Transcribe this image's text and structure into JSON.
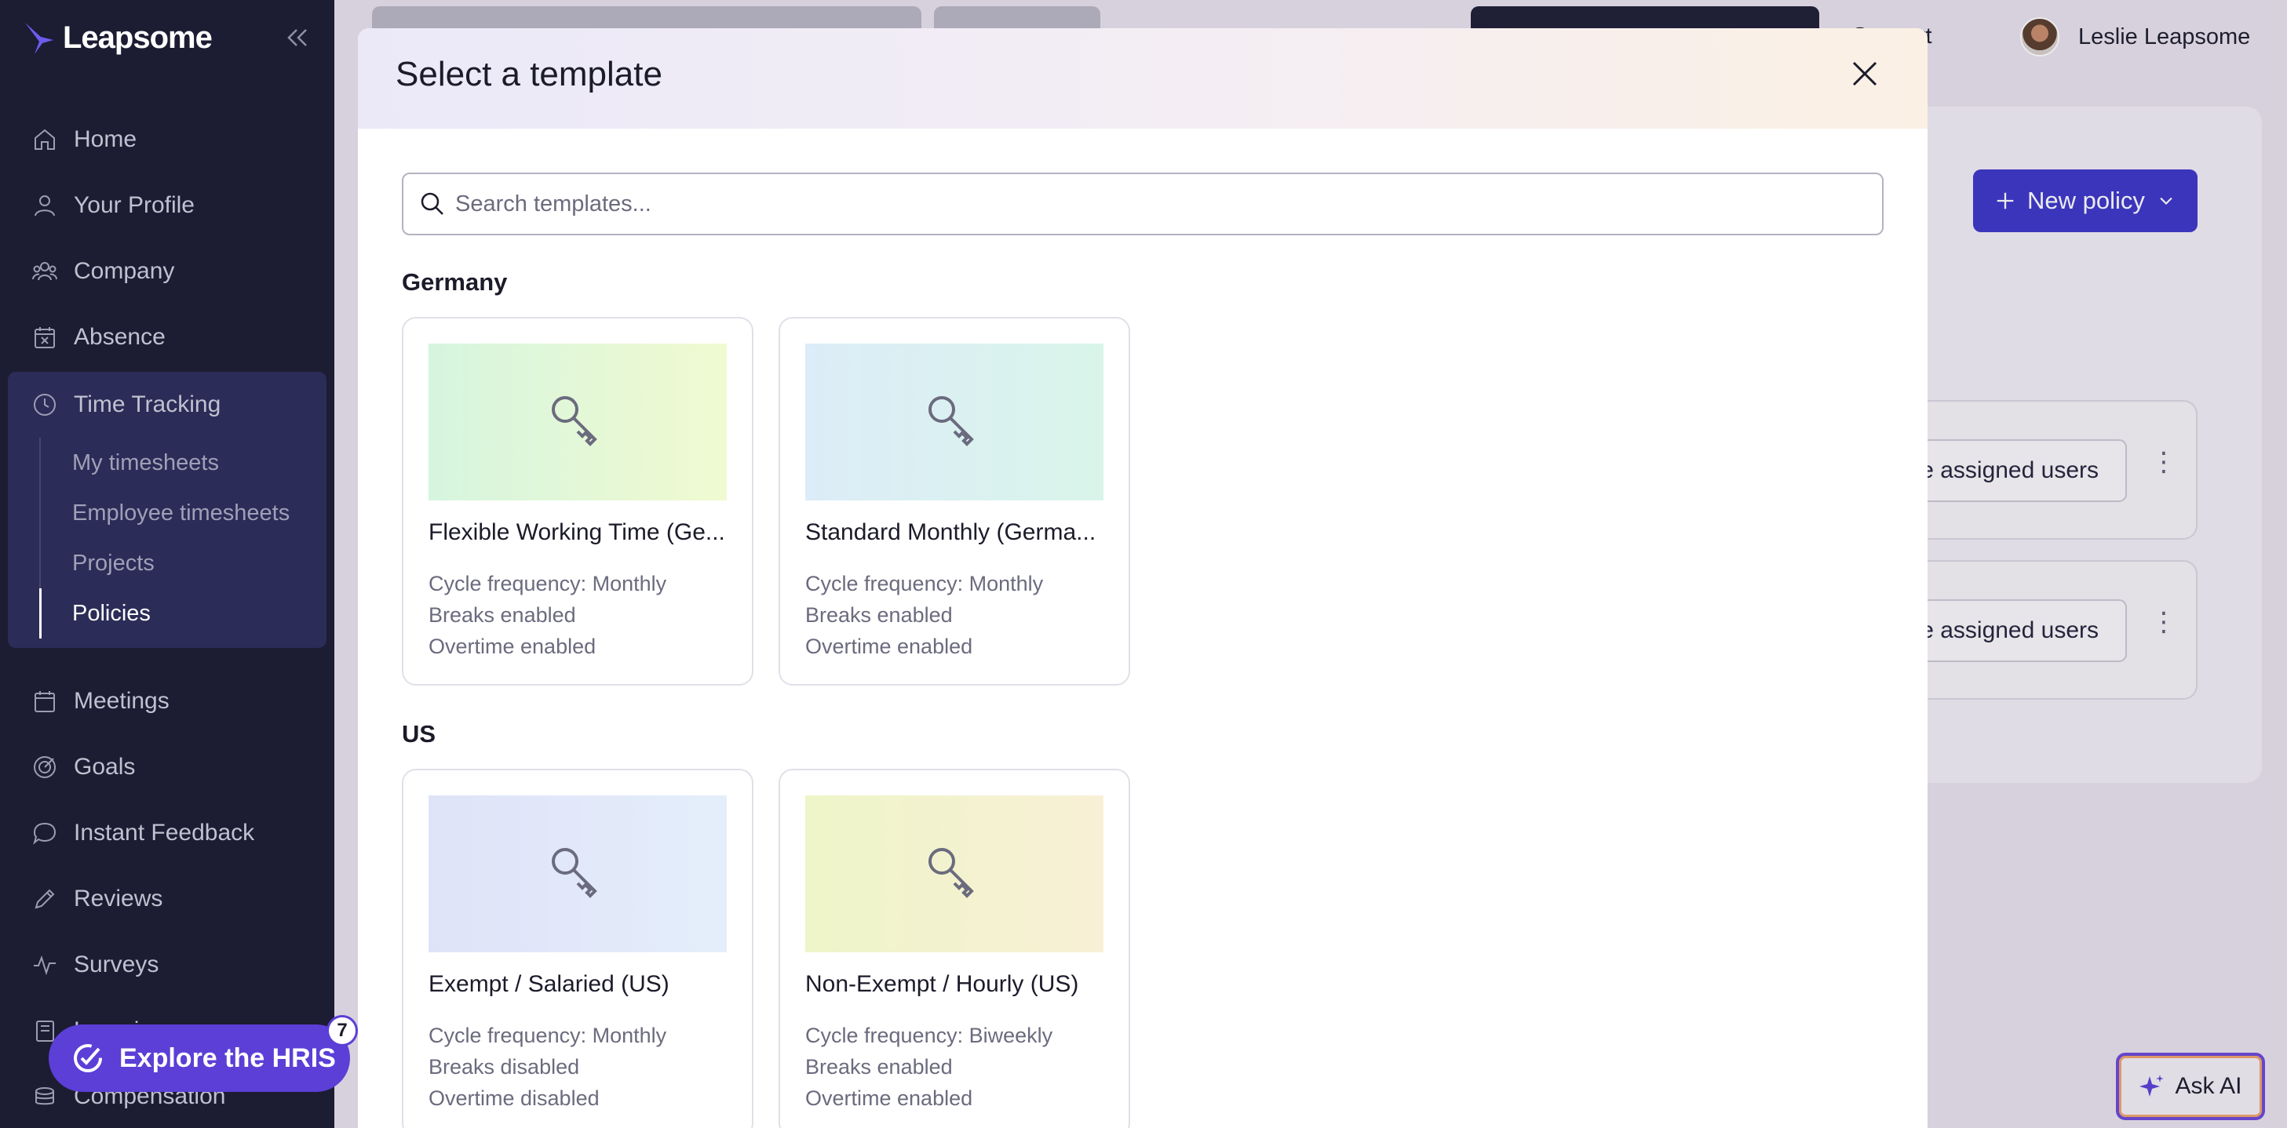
{
  "app": {
    "name": "Leapsome"
  },
  "sidebar": {
    "items_top": [
      {
        "label": "Home"
      },
      {
        "label": "Your Profile"
      },
      {
        "label": "Company"
      },
      {
        "label": "Absence"
      }
    ],
    "time_tracking": {
      "label": "Time Tracking",
      "sub_items": [
        {
          "label": "My timesheets"
        },
        {
          "label": "Employee timesheets"
        },
        {
          "label": "Projects"
        },
        {
          "label": "Policies"
        }
      ]
    },
    "items_bottom": [
      {
        "label": "Meetings"
      },
      {
        "label": "Goals"
      },
      {
        "label": "Instant Feedback"
      },
      {
        "label": "Reviews"
      },
      {
        "label": "Surveys"
      },
      {
        "label": "Learning"
      },
      {
        "label": "Compensation"
      }
    ]
  },
  "header": {
    "support_label": "Support",
    "user_name": "Leslie Leapsome"
  },
  "main": {
    "new_policy_label": "New policy",
    "row_button_label": "Manage assigned users"
  },
  "modal": {
    "title": "Select a template",
    "search_placeholder": "Search templates...",
    "sections": [
      {
        "heading": "Germany",
        "templates": [
          {
            "name": "Flexible Working Time (Ge...",
            "cycle": "Cycle frequency: Monthly",
            "breaks": "Breaks enabled",
            "overtime": "Overtime enabled"
          },
          {
            "name": "Standard Monthly (Germa...",
            "cycle": "Cycle frequency: Monthly",
            "breaks": "Breaks enabled",
            "overtime": "Overtime enabled"
          }
        ]
      },
      {
        "heading": "US",
        "templates": [
          {
            "name": "Exempt / Salaried (US)",
            "cycle": "Cycle frequency: Monthly",
            "breaks": "Breaks disabled",
            "overtime": "Overtime disabled"
          },
          {
            "name": "Non-Exempt / Hourly (US)",
            "cycle": "Cycle frequency: Biweekly",
            "breaks": "Breaks enabled",
            "overtime": "Overtime enabled"
          }
        ]
      }
    ]
  },
  "explore": {
    "label": "Explore the HRIS",
    "badge": "7"
  },
  "ask_ai": {
    "label": "Ask AI"
  },
  "colors": {
    "sidebar_bg": "#1c1c33",
    "accent": "#3b35c9",
    "explore": "#5b3fd6"
  }
}
